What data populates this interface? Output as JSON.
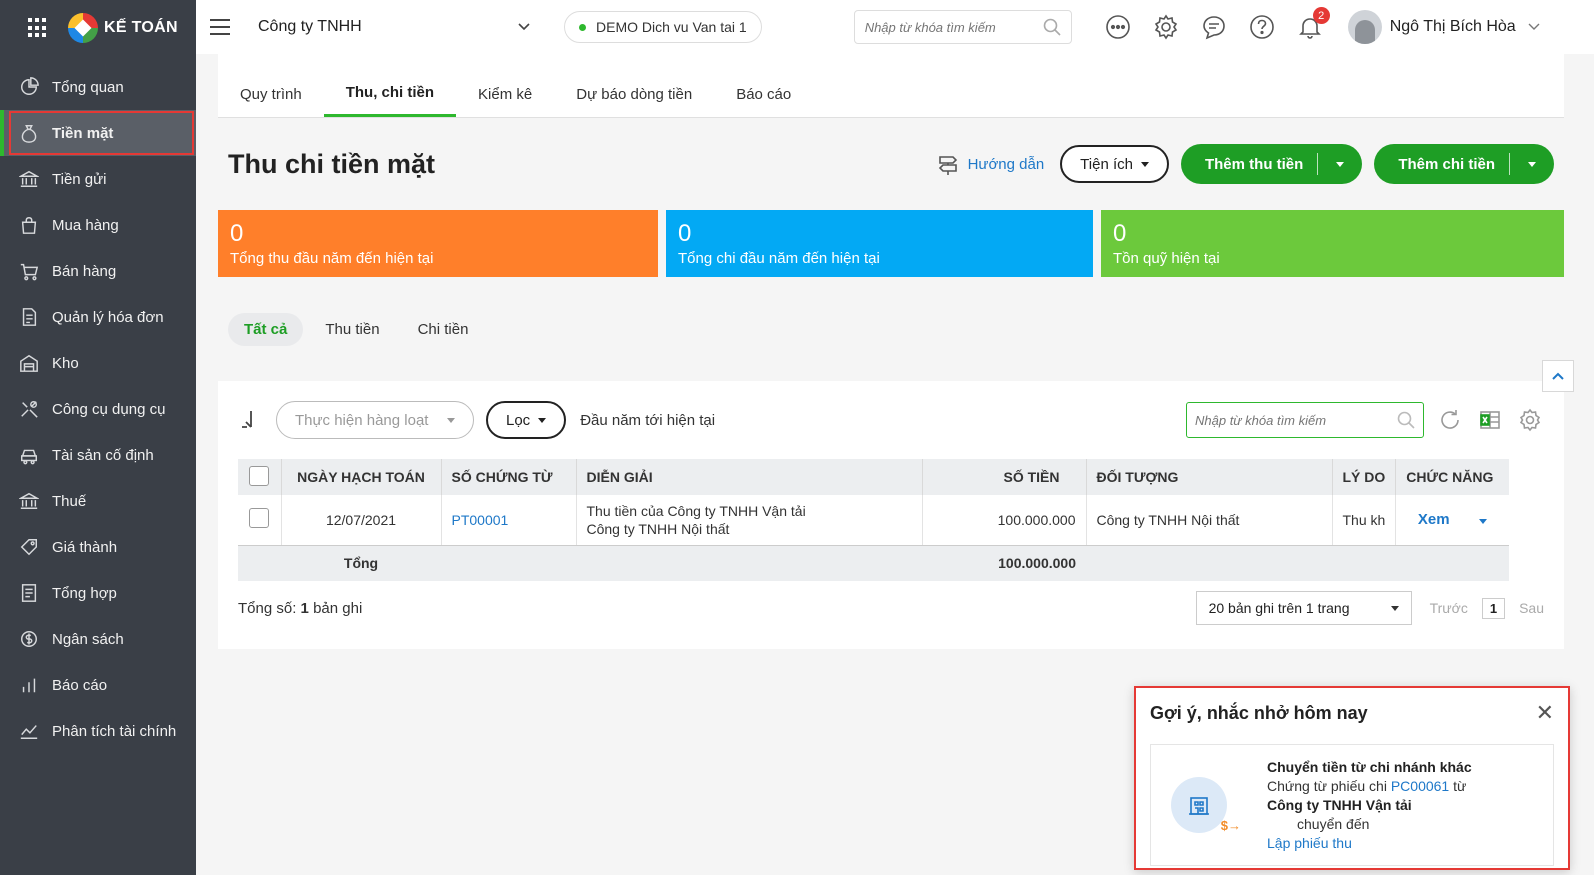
{
  "app": {
    "brand": "KẾ TOÁN"
  },
  "sidebar": {
    "items": [
      {
        "label": "Tổng quan",
        "icon": "dashboard-icon"
      },
      {
        "label": "Tiền mặt",
        "icon": "cash-bag-icon",
        "active": true
      },
      {
        "label": "Tiền gửi",
        "icon": "bank-icon"
      },
      {
        "label": "Mua hàng",
        "icon": "shopping-bag-icon"
      },
      {
        "label": "Bán hàng",
        "icon": "cart-icon"
      },
      {
        "label": "Quản lý hóa đơn",
        "icon": "invoice-icon"
      },
      {
        "label": "Kho",
        "icon": "warehouse-icon"
      },
      {
        "label": "Công cụ dụng cụ",
        "icon": "tools-icon"
      },
      {
        "label": "Tài sản cố định",
        "icon": "car-icon"
      },
      {
        "label": "Thuế",
        "icon": "tax-building-icon"
      },
      {
        "label": "Giá thành",
        "icon": "price-tag-icon"
      },
      {
        "label": "Tổng hợp",
        "icon": "summary-icon"
      },
      {
        "label": "Ngân sách",
        "icon": "budget-icon"
      },
      {
        "label": "Báo cáo",
        "icon": "bar-chart-icon"
      },
      {
        "label": "Phân tích tài chính",
        "icon": "line-chart-icon"
      }
    ]
  },
  "topbar": {
    "company": "Công ty TNHH",
    "demo": "DEMO Dich vu Van tai 1",
    "search_placeholder": "Nhập từ khóa tìm kiếm",
    "notification_count": "2",
    "user_name": "Ngô Thị Bích Hòa"
  },
  "tabs": [
    {
      "label": "Quy trình"
    },
    {
      "label": "Thu, chi tiền",
      "active": true
    },
    {
      "label": "Kiểm kê"
    },
    {
      "label": "Dự báo dòng tiền"
    },
    {
      "label": "Báo cáo"
    }
  ],
  "header": {
    "title": "Thu chi tiền mặt",
    "guide": "Hướng dẫn",
    "utilities": "Tiện ích",
    "add_receipt": "Thêm thu tiền",
    "add_payment": "Thêm chi tiền"
  },
  "summary_cards": [
    {
      "value": "0",
      "label": "Tổng thu đầu năm đến hiện tại",
      "color": "#ff7f2a"
    },
    {
      "value": "0",
      "label": "Tổng chi đầu năm đến hiện tại",
      "color": "#03a9f4"
    },
    {
      "value": "0",
      "label": "Tồn quỹ hiện tại",
      "color": "#6cc93c"
    }
  ],
  "filter_tabs": [
    {
      "label": "Tất cả",
      "active": true
    },
    {
      "label": "Thu tiền"
    },
    {
      "label": "Chi tiền"
    }
  ],
  "toolbar": {
    "bulk_action": "Thực hiện hàng loạt",
    "filter": "Lọc",
    "period": "Đầu năm tới hiện tại",
    "search_placeholder": "Nhập từ khóa tìm kiếm"
  },
  "table": {
    "columns": [
      "NGÀY HẠCH TOÁN",
      "SỐ CHỨNG TỪ",
      "DIỄN GIẢI",
      "SỐ TIỀN",
      "ĐỐI TƯỢNG",
      "LÝ DO",
      "CHỨC NĂNG"
    ],
    "rows": [
      {
        "date": "12/07/2021",
        "doc_no": "PT00001",
        "description_line1": "Thu tiền của Công ty TNHH Vận tải",
        "description_line2": "Công ty TNHH Nội thất",
        "amount": "100.000.000",
        "object": "Công ty TNHH Nội thất",
        "reason": "Thu kh",
        "action": "Xem"
      }
    ],
    "total_label": "Tổng",
    "total_amount": "100.000.000"
  },
  "pager": {
    "total_prefix": "Tổng số:",
    "total_count": "1",
    "total_suffix": "bản ghi",
    "page_size": "20 bản ghi trên 1 trang",
    "prev": "Trước",
    "page": "1",
    "next": "Sau"
  },
  "reminder": {
    "title": "Gợi ý, nhắc nhở hôm nay",
    "item_title": "Chuyển tiền từ chi nhánh khác",
    "line_prefix": "Chứng từ phiếu chi",
    "doc_link": "PC00061",
    "line_suffix": "từ",
    "company": "Công ty TNHH Vận tải",
    "transferred": "chuyển đến",
    "action": "Lập phiếu thu",
    "money_glyph": "$→"
  }
}
